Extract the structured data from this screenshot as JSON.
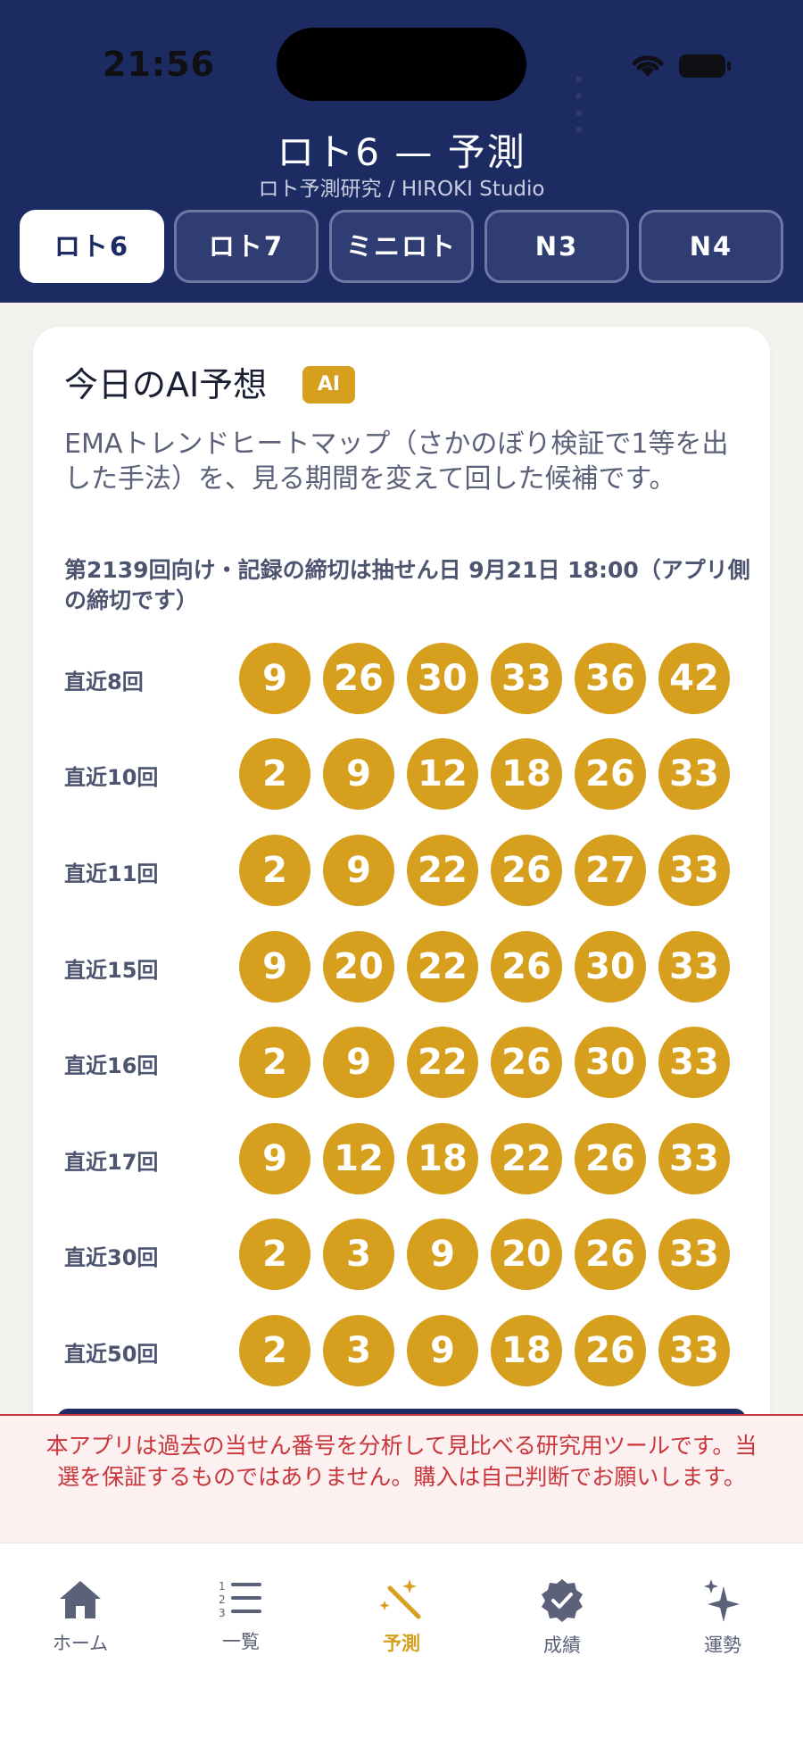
{
  "status_bar": {
    "time": "21:56"
  },
  "header": {
    "title": "ロト6 — 予測",
    "subtitle": "ロト予測研究 / HIROKI Studio",
    "tabs": [
      {
        "label": "ロト6",
        "active": true
      },
      {
        "label": "ロト7",
        "active": false
      },
      {
        "label": "ミニロト",
        "active": false
      },
      {
        "label": "N3",
        "active": false
      },
      {
        "label": "N4",
        "active": false
      }
    ]
  },
  "card": {
    "title": "今日のAI予想",
    "badge": "AI",
    "description": "EMAトレンドヒートマップ（さかのぼり検証で1等を出した手法）を、見る期間を変えて回した候補です。",
    "deadline": "第2139回向け・記録の締切は抽せん日 9月21日 18:00（アプリ側の締切です）",
    "rows": [
      {
        "label": "直近8回",
        "numbers": [
          "9",
          "26",
          "30",
          "33",
          "36",
          "42"
        ]
      },
      {
        "label": "直近10回",
        "numbers": [
          "2",
          "9",
          "12",
          "18",
          "26",
          "33"
        ]
      },
      {
        "label": "直近11回",
        "numbers": [
          "2",
          "9",
          "22",
          "26",
          "27",
          "33"
        ]
      },
      {
        "label": "直近15回",
        "numbers": [
          "9",
          "20",
          "22",
          "26",
          "30",
          "33"
        ]
      },
      {
        "label": "直近16回",
        "numbers": [
          "2",
          "9",
          "22",
          "26",
          "30",
          "33"
        ]
      },
      {
        "label": "直近17回",
        "numbers": [
          "9",
          "12",
          "18",
          "22",
          "26",
          "33"
        ]
      },
      {
        "label": "直近30回",
        "numbers": [
          "2",
          "3",
          "9",
          "20",
          "26",
          "33"
        ]
      },
      {
        "label": "直近50回",
        "numbers": [
          "2",
          "3",
          "9",
          "18",
          "26",
          "33"
        ]
      }
    ]
  },
  "disclaimer": "本アプリは過去の当せん番号を分析して見比べる研究用ツールです。当選を保証するものではありません。購入は自己判断でお願いします。",
  "bottom_nav": [
    {
      "label": "ホーム",
      "icon": "home-icon",
      "active": false
    },
    {
      "label": "一覧",
      "icon": "numbered-list-icon",
      "active": false
    },
    {
      "label": "予測",
      "icon": "magic-wand-icon",
      "active": true
    },
    {
      "label": "成績",
      "icon": "verified-badge-icon",
      "active": false
    },
    {
      "label": "運勢",
      "icon": "sparkles-icon",
      "active": false
    }
  ],
  "colors": {
    "header_bg": "#1c2b62",
    "accent_gold": "#d6a01e",
    "disclaimer_red": "#c8363c"
  }
}
